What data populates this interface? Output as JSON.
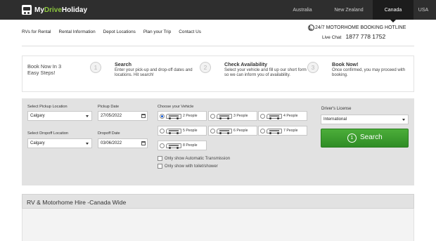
{
  "brand": {
    "my": "My",
    "drive": "Drive",
    "holiday": "Holiday"
  },
  "countries": [
    "Australia",
    "New Zealand",
    "Canada",
    "USA"
  ],
  "active_country": "Canada",
  "nav": [
    "RVs for Rental",
    "Rental Information",
    "Depot Locations",
    "Plan your Trip",
    "Contact Us"
  ],
  "hotline": {
    "title": "24/7 MOTORHOME BOOKING HOTLINE",
    "live_chat": "Live Chat",
    "phone": "1877 778 1752"
  },
  "steps": {
    "intro": "Book Now In 3 Easy Steps!",
    "items": [
      {
        "number": "1",
        "title": "Search",
        "desc": "Enter your pick-up and drop-off dates and locations. Hit search!"
      },
      {
        "number": "2",
        "title": "Check Availability",
        "desc": "Select your vehicle and fill up our short form so we can inform you of availability."
      },
      {
        "number": "3",
        "title": "Book Now!",
        "desc": "Once confirmed, you may proceed with booking."
      }
    ]
  },
  "search": {
    "pickup_location_label": "Select Pickup Location",
    "pickup_location": "Calgary",
    "pickup_date_label": "Pickup Date",
    "pickup_date": "27/05/2022",
    "dropoff_location_label": "Select Dropoff Location",
    "dropoff_location": "Calgary",
    "dropoff_date_label": "Dropoff Date",
    "dropoff_date": "03/06/2022",
    "vehicle_label": "Choose your Vehicle",
    "vehicles": [
      "2 People",
      "3 People",
      "4 People",
      "5 People",
      "6 People",
      "7 People",
      "8 People"
    ],
    "selected_vehicle": "2 People",
    "option_automatic": "Only show Automatic Transmission",
    "option_toilet": "Only show with toilet/shower",
    "license_label": "Driver's License",
    "license_value": "International",
    "search_number": "1",
    "search_button": "Search"
  },
  "banner": "RV & Motorhome Hire -Canada Wide",
  "colors": {
    "topbar": "#2e2e2e",
    "brand_green": "#8cc63f",
    "search_button": "#3a9b2e",
    "panel": "#e2e2e2"
  }
}
